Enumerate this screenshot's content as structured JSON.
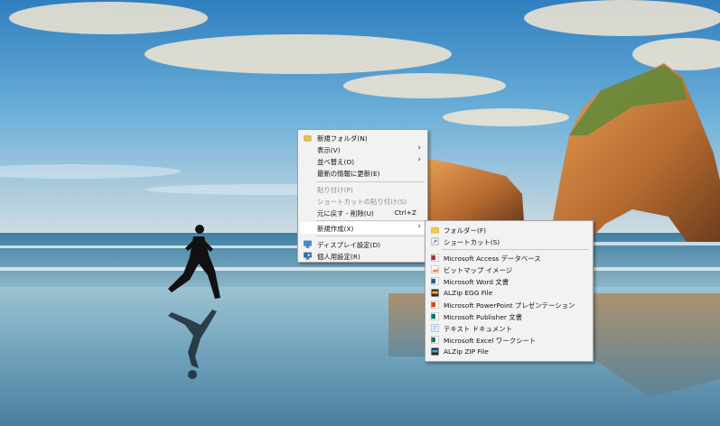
{
  "context_menu": {
    "items": [
      {
        "label": "新規フォルダ(N)",
        "icon": "new-folder-icon"
      },
      {
        "label": "表示(V)",
        "has_submenu": true
      },
      {
        "label": "並べ替え(O)",
        "has_submenu": true
      },
      {
        "label": "最新の情報に更新(E)"
      },
      {
        "label": "貼り付け(P)",
        "disabled": true
      },
      {
        "label": "ショートカットの貼り付け(S)",
        "disabled": true
      },
      {
        "label": "元に戻す - 削除(U)",
        "shortcut": "Ctrl+Z"
      },
      {
        "label": "新規作成(X)",
        "has_submenu": true,
        "highlighted": true
      },
      {
        "label": "ディスプレイ設定(D)",
        "icon": "display-settings-icon"
      },
      {
        "label": "個人用設定(R)",
        "icon": "personalize-icon"
      }
    ]
  },
  "new_submenu": {
    "items": [
      {
        "label": "フォルダー(F)",
        "icon": "folder-icon"
      },
      {
        "label": "ショートカット(S)",
        "icon": "shortcut-icon"
      },
      {
        "label": "Microsoft Access データベース",
        "icon": "access-icon"
      },
      {
        "label": "ビットマップ イメージ",
        "icon": "bitmap-icon"
      },
      {
        "label": "Microsoft Word 文書",
        "icon": "word-icon"
      },
      {
        "label": "ALZip EGG File",
        "icon": "egg-file-icon"
      },
      {
        "label": "Microsoft PowerPoint プレゼンテーション",
        "icon": "powerpoint-icon"
      },
      {
        "label": "Microsoft Publisher 文書",
        "icon": "publisher-icon"
      },
      {
        "label": "テキスト ドキュメント",
        "icon": "text-document-icon"
      },
      {
        "label": "Microsoft Excel ワークシート",
        "icon": "excel-icon"
      },
      {
        "label": "ALZip ZIP File",
        "icon": "zip-file-icon"
      }
    ]
  },
  "colors": {
    "menu_background": "#f2f2f2",
    "menu_highlight": "#ffffff",
    "disabled_text": "#8c8c8c"
  }
}
